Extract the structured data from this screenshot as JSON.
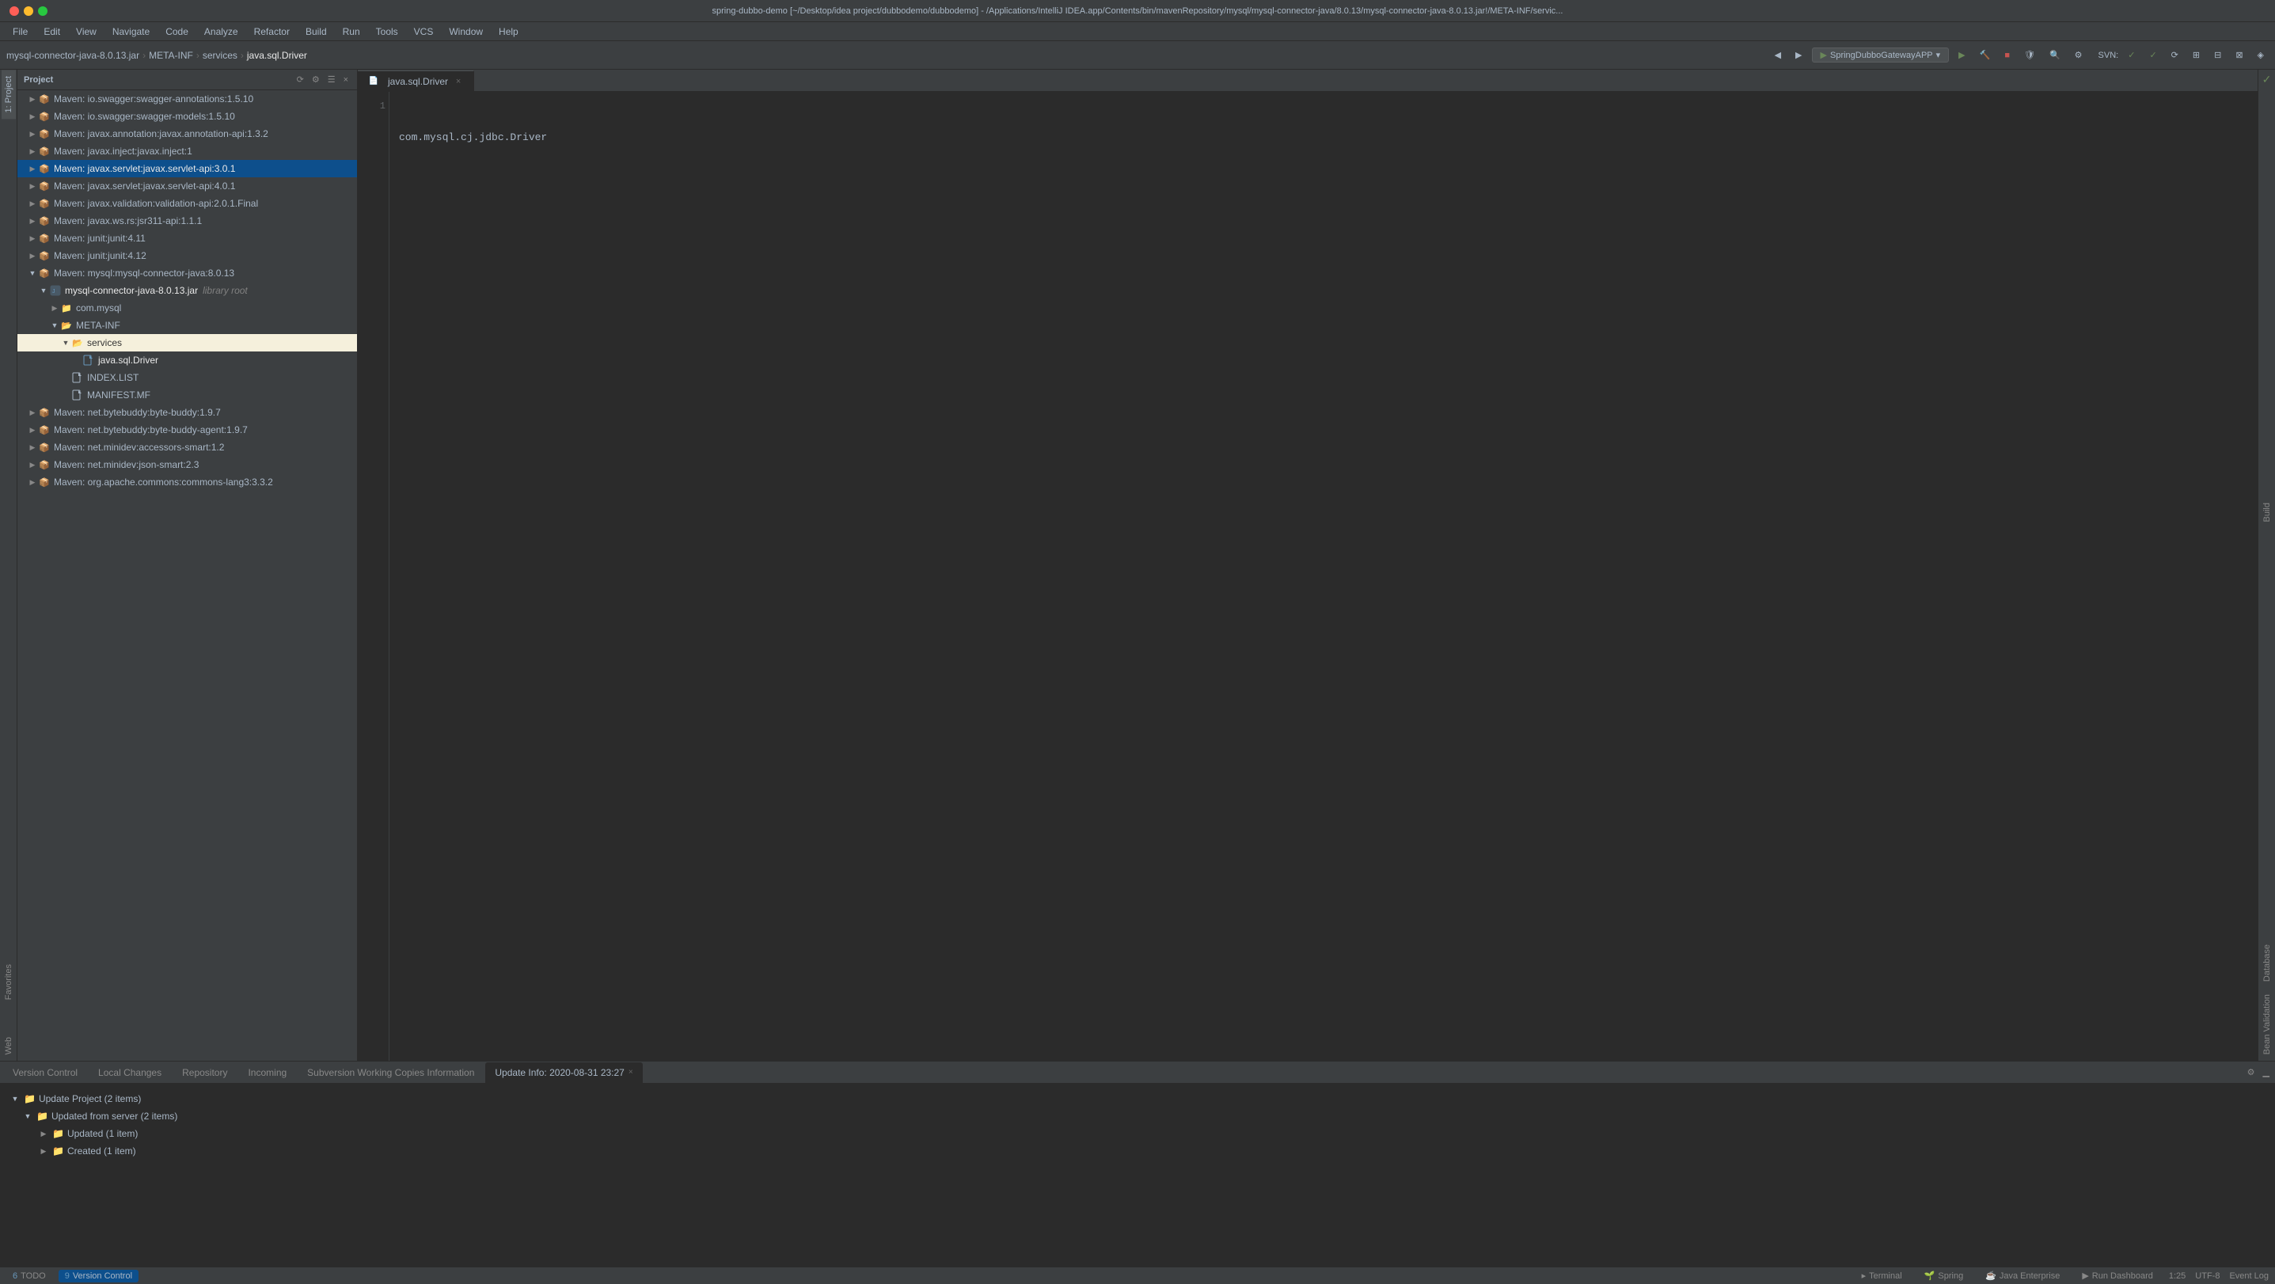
{
  "titleBar": {
    "title": "spring-dubbo-demo [~/Desktop/idea project/dubbodemo/dubbodemo] - /Applications/IntelliJ IDEA.app/Contents/bin/mavenRepository/mysql/mysql-connector-java/8.0.13/mysql-connector-java-8.0.13.jar!/META-INF/servic..."
  },
  "menuBar": {
    "items": [
      "File",
      "Edit",
      "View",
      "Navigate",
      "Code",
      "Analyze",
      "Refactor",
      "Build",
      "Run",
      "Tools",
      "VCS",
      "Window",
      "Help"
    ]
  },
  "toolbar": {
    "breadcrumbs": [
      "mysql-connector-java-8.0.13.jar",
      "META-INF",
      "services",
      "java.sql.Driver"
    ],
    "runConfig": "SpringDubboGatewayAPP",
    "svnLabel": "SVN:"
  },
  "projectPanel": {
    "title": "Project",
    "treeItems": [
      {
        "id": "maven-swagger-annotations",
        "level": 1,
        "expanded": false,
        "label": "Maven: io.swagger:swagger-annotations:1.5.10",
        "type": "maven"
      },
      {
        "id": "maven-swagger-models",
        "level": 1,
        "expanded": false,
        "label": "Maven: io.swagger:swagger-models:1.5.10",
        "type": "maven"
      },
      {
        "id": "maven-javax-annotation",
        "level": 1,
        "expanded": false,
        "label": "Maven: javax.annotation:javax.annotation-api:1.3.2",
        "type": "maven"
      },
      {
        "id": "maven-javax-inject",
        "level": 1,
        "expanded": false,
        "label": "Maven: javax.inject:javax.inject:1",
        "type": "maven"
      },
      {
        "id": "maven-javax-servlet-3",
        "level": 1,
        "expanded": false,
        "label": "Maven: javax.servlet:javax.servlet-api:3.0.1",
        "type": "maven",
        "selected": true
      },
      {
        "id": "maven-javax-servlet-4",
        "level": 1,
        "expanded": false,
        "label": "Maven: javax.servlet:javax.servlet-api:4.0.1",
        "type": "maven"
      },
      {
        "id": "maven-javax-validation",
        "level": 1,
        "expanded": false,
        "label": "Maven: javax.validation:validation-api:2.0.1.Final",
        "type": "maven"
      },
      {
        "id": "maven-javax-ws",
        "level": 1,
        "expanded": false,
        "label": "Maven: javax.ws.rs:jsr311-api:1.1.1",
        "type": "maven"
      },
      {
        "id": "maven-junit-411",
        "level": 1,
        "expanded": false,
        "label": "Maven: junit:junit:4.11",
        "type": "maven"
      },
      {
        "id": "maven-junit-412",
        "level": 1,
        "expanded": false,
        "label": "Maven: junit:junit:4.12",
        "type": "maven"
      },
      {
        "id": "maven-mysql",
        "level": 1,
        "expanded": true,
        "label": "Maven: mysql:mysql-connector-java:8.0.13",
        "type": "maven"
      },
      {
        "id": "mysql-jar",
        "level": 2,
        "expanded": true,
        "label": "mysql-connector-java-8.0.13.jar",
        "sublabel": "library root",
        "type": "jar"
      },
      {
        "id": "com-mysql",
        "level": 3,
        "expanded": false,
        "label": "com.mysql",
        "type": "package"
      },
      {
        "id": "meta-inf",
        "level": 3,
        "expanded": true,
        "label": "META-INF",
        "type": "folder"
      },
      {
        "id": "services",
        "level": 4,
        "expanded": true,
        "label": "services",
        "type": "folder-blue"
      },
      {
        "id": "java-sql-driver",
        "level": 5,
        "expanded": false,
        "label": "java.sql.Driver",
        "type": "file-driver",
        "active": true
      },
      {
        "id": "index-list",
        "level": 4,
        "expanded": false,
        "label": "INDEX.LIST",
        "type": "file-list"
      },
      {
        "id": "manifest-mf",
        "level": 4,
        "expanded": false,
        "label": "MANIFEST.MF",
        "type": "file-manifest"
      },
      {
        "id": "maven-bytebuddy",
        "level": 1,
        "expanded": false,
        "label": "Maven: net.bytebuddy:byte-buddy:1.9.7",
        "type": "maven"
      },
      {
        "id": "maven-bytebuddy-agent",
        "level": 1,
        "expanded": false,
        "label": "Maven: net.bytebuddy:byte-buddy-agent:1.9.7",
        "type": "maven"
      },
      {
        "id": "maven-minidev-accessors",
        "level": 1,
        "expanded": false,
        "label": "Maven: net.minidev:accessors-smart:1.2",
        "type": "maven"
      },
      {
        "id": "maven-minidev-json",
        "level": 1,
        "expanded": false,
        "label": "Maven: net.minidev:json-smart:2.3",
        "type": "maven"
      },
      {
        "id": "maven-apache-commons",
        "level": 1,
        "expanded": false,
        "label": "Maven: org.apache.commons:commons-lang3:3.3.2",
        "type": "maven"
      }
    ]
  },
  "editor": {
    "tabs": [
      {
        "id": "java-sql-driver-tab",
        "label": "java.sql.Driver",
        "active": true,
        "closable": true
      }
    ],
    "content": "com.mysql.cj.jdbc.Driver",
    "lineNumber": 1
  },
  "rightPanel": {
    "labels": [
      "Build"
    ]
  },
  "bottomPanel": {
    "tabs": [
      {
        "id": "version-control",
        "label": "Version Control",
        "active": false
      },
      {
        "id": "local-changes",
        "label": "Local Changes",
        "active": false
      },
      {
        "id": "repository",
        "label": "Repository",
        "active": false
      },
      {
        "id": "incoming",
        "label": "Incoming",
        "active": false
      },
      {
        "id": "svn-info",
        "label": "Subversion Working Copies Information",
        "active": false
      },
      {
        "id": "update-info",
        "label": "Update Info: 2020-08-31 23:27",
        "active": true,
        "closable": true
      }
    ],
    "treeItems": [
      {
        "id": "update-project",
        "level": 0,
        "expanded": true,
        "label": "Update Project (2 items)",
        "type": "folder"
      },
      {
        "id": "updated-from-server",
        "level": 1,
        "expanded": true,
        "label": "Updated from server (2 items)",
        "type": "folder"
      },
      {
        "id": "updated-1",
        "level": 2,
        "expanded": false,
        "label": "Updated (1 item)",
        "type": "folder"
      },
      {
        "id": "created-1",
        "level": 2,
        "expanded": false,
        "label": "Created (1 item)",
        "type": "folder"
      }
    ]
  },
  "statusBar": {
    "leftTabs": [
      {
        "id": "todo",
        "num": "6",
        "label": "TODO"
      },
      {
        "id": "version-control",
        "num": "9",
        "label": "Version Control",
        "active": true
      }
    ],
    "rightTabs": [
      {
        "id": "terminal",
        "label": "Terminal"
      },
      {
        "id": "spring",
        "label": "Spring"
      },
      {
        "id": "java-enterprise",
        "label": "Java Enterprise"
      },
      {
        "id": "run-dashboard",
        "label": "Run Dashboard"
      }
    ],
    "position": "1:25",
    "encoding": "UTF-8",
    "eventLog": "Event Log"
  },
  "leftSideTabs": [
    {
      "id": "project",
      "label": "1: Project",
      "active": true
    },
    {
      "id": "favorites",
      "label": "Favorites"
    },
    {
      "id": "web",
      "label": "Web"
    }
  ]
}
